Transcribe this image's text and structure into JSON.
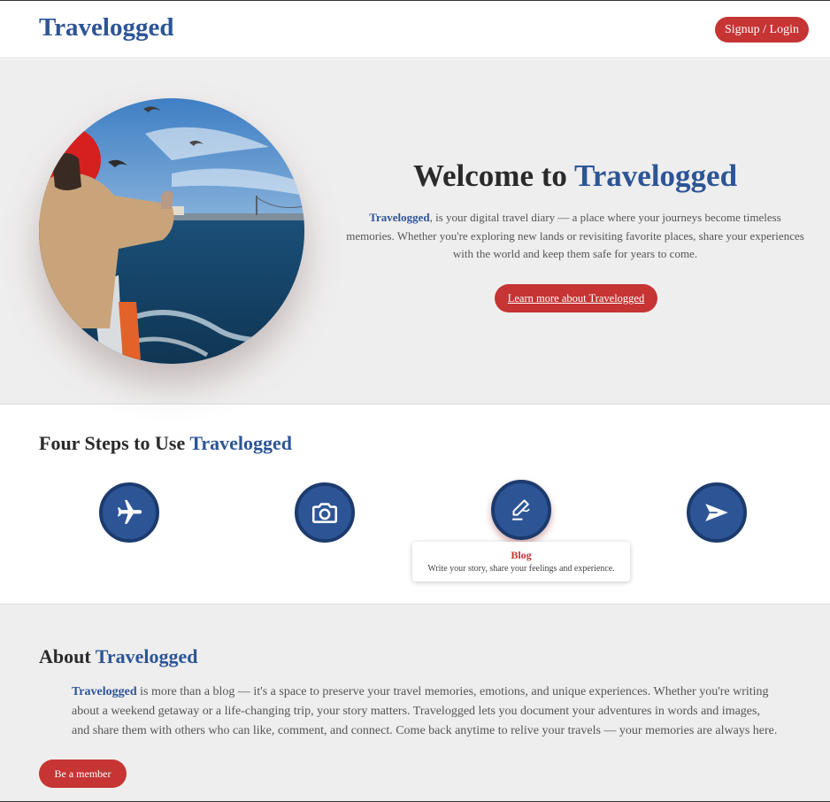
{
  "header": {
    "logo": "Travelogged",
    "signup_label": "Signup / Login"
  },
  "hero": {
    "title_prefix": "Welcome to ",
    "title_brand": "Travelogged",
    "desc_brand": "Travelogged",
    "desc_rest": ", is your digital travel diary — a place where your journeys become timeless memories. Whether you're exploring new lands or revisiting favorite places, share your experiences with the world and keep them safe for years to come.",
    "learn_more_label": "Learn more about Travelogged",
    "photo": "ferry-seagulls-photo"
  },
  "steps": {
    "title_prefix": "Four Steps to Use ",
    "title_brand": "Travelogged",
    "items": [
      {
        "icon": "airplane-icon"
      },
      {
        "icon": "camera-icon"
      },
      {
        "icon": "pen-writing-icon"
      },
      {
        "icon": "send-icon"
      }
    ],
    "tooltip": {
      "title": "Blog",
      "text": "Write your story, share your feelings and experience."
    }
  },
  "about": {
    "title_prefix": "About ",
    "title_brand": "Travelogged",
    "text_brand": "Travelogged",
    "text_rest": " is more than a blog — it's a space to preserve your travel memories, emotions, and unique experiences. Whether you're writing about a weekend getaway or a life-changing trip, your story matters. Travelogged lets you document your adventures in words and images, and share them with others who can like, comment, and connect. Come back anytime to relive your travels — your memories are always here.",
    "member_label": "Be a member"
  },
  "colors": {
    "brand_blue": "#2d5596",
    "accent_red": "#c63434",
    "section_gray": "#efeeee"
  }
}
